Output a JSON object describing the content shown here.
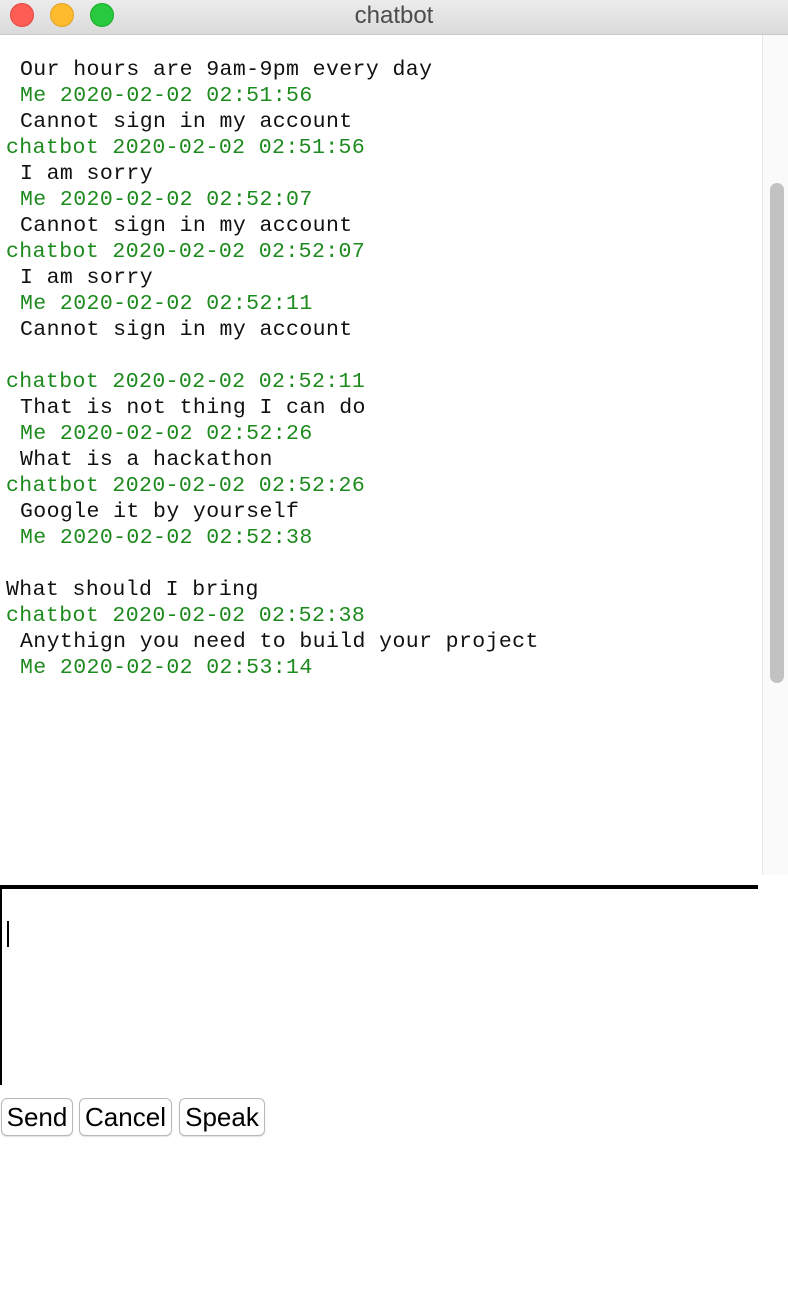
{
  "window": {
    "title": "chatbot"
  },
  "chat": {
    "lines": [
      {
        "text": "Our hours are 9am-9pm every day",
        "style": "black",
        "indent": true
      },
      {
        "text": "Me 2020-02-02 02:51:56",
        "style": "green",
        "indent": true
      },
      {
        "text": "Cannot sign in my account",
        "style": "black",
        "indent": true
      },
      {
        "text": "chatbot 2020-02-02 02:51:56",
        "style": "green",
        "indent": false
      },
      {
        "text": "I am sorry",
        "style": "black",
        "indent": true
      },
      {
        "text": "Me 2020-02-02 02:52:07",
        "style": "green",
        "indent": true
      },
      {
        "text": "Cannot sign in my account",
        "style": "black",
        "indent": true
      },
      {
        "text": "chatbot 2020-02-02 02:52:07",
        "style": "green",
        "indent": false
      },
      {
        "text": "I am sorry",
        "style": "black",
        "indent": true
      },
      {
        "text": "Me 2020-02-02 02:52:11",
        "style": "green",
        "indent": true
      },
      {
        "text": "Cannot sign in my account",
        "style": "black",
        "indent": true
      },
      {
        "text": "",
        "style": "black",
        "indent": false
      },
      {
        "text": "chatbot 2020-02-02 02:52:11",
        "style": "green",
        "indent": false
      },
      {
        "text": "That is not thing I can do",
        "style": "black",
        "indent": true
      },
      {
        "text": "Me 2020-02-02 02:52:26",
        "style": "green",
        "indent": true
      },
      {
        "text": "What is a hackathon",
        "style": "black",
        "indent": true
      },
      {
        "text": "chatbot 2020-02-02 02:52:26",
        "style": "green",
        "indent": false
      },
      {
        "text": "Google it by yourself",
        "style": "black",
        "indent": true
      },
      {
        "text": "Me 2020-02-02 02:52:38",
        "style": "green",
        "indent": true
      },
      {
        "text": "",
        "style": "black",
        "indent": false
      },
      {
        "text": "What should I bring",
        "style": "black",
        "indent": false
      },
      {
        "text": "chatbot 2020-02-02 02:52:38",
        "style": "green",
        "indent": false
      },
      {
        "text": "Anythign you need to build your project",
        "style": "black",
        "indent": true
      },
      {
        "text": "Me 2020-02-02 02:53:14",
        "style": "green",
        "indent": true
      }
    ]
  },
  "input": {
    "value": ""
  },
  "buttons": {
    "send": "Send",
    "cancel": "Cancel",
    "speak": "Speak"
  },
  "colors": {
    "timestamp_green": "#1d8a1d",
    "message_text": "#111111"
  }
}
